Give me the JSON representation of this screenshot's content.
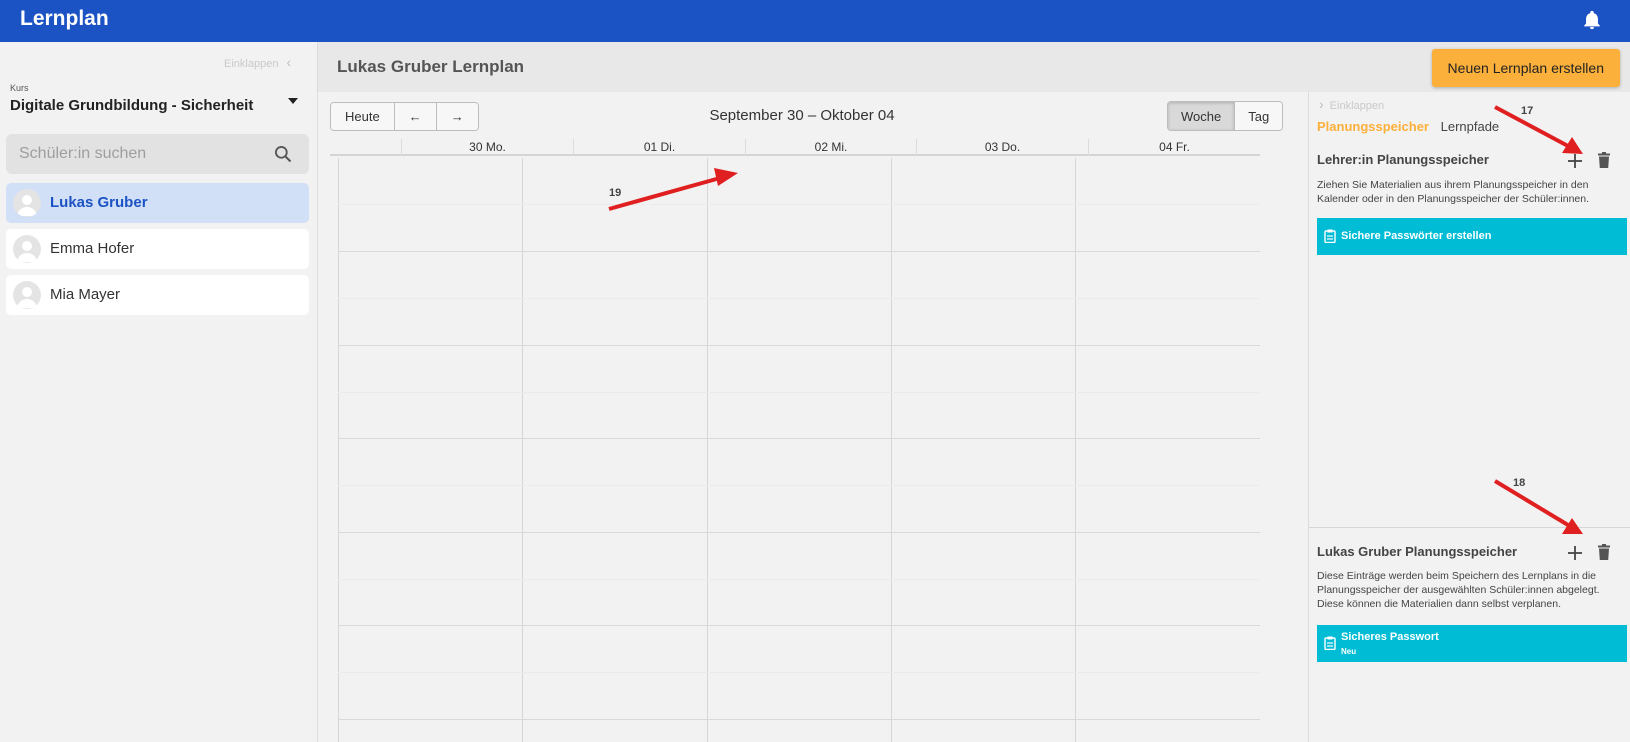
{
  "app": {
    "title": "Lernplan"
  },
  "sidebar": {
    "collapse_label": "Einklappen",
    "kurs_label": "Kurs",
    "kurs_value": "Digitale Grundbildung - Sicherheit",
    "search_placeholder": "Schüler:in suchen",
    "students": [
      {
        "name": "Lukas Gruber",
        "active": true
      },
      {
        "name": "Emma Hofer",
        "active": false
      },
      {
        "name": "Mia Mayer",
        "active": false
      }
    ]
  },
  "main": {
    "title": "Lukas Gruber Lernplan",
    "new_plan_button": "Neuen Lernplan erstellen"
  },
  "calendar": {
    "today_button": "Heute",
    "prev_button": "←",
    "next_button": "→",
    "date_range": "September 30 – Oktober 04",
    "view_week": "Woche",
    "view_day": "Tag",
    "active_view": "Woche",
    "days": [
      "30 Mo.",
      "01 Di.",
      "02 Mi.",
      "03 Do.",
      "04 Fr."
    ]
  },
  "right_panel": {
    "collapse_label": "Einklappen",
    "tab_active": "Planungsspeicher",
    "tab_other": "Lernpfade",
    "teacher_section": {
      "title": "Lehrer:in Planungsspeicher",
      "description": "Ziehen Sie Materialien aus ihrem Planungsspeicher in den Kalender oder in den Planungsspeicher der Schüler:innen.",
      "items": [
        {
          "title": "Sichere Passwörter erstellen"
        }
      ]
    },
    "student_section": {
      "title": "Lukas Gruber Planungsspeicher",
      "description": "Diese Einträge werden beim Speichern des Lernplans in die Planungsspeicher der ausgewählten Schüler:innen abgelegt. Diese können die Materialien dann selbst verplanen.",
      "items": [
        {
          "title": "Sicheres Passwort",
          "subtitle": "Neu"
        }
      ]
    }
  },
  "annotations": {
    "label_17": "17",
    "label_18": "18",
    "label_19": "19",
    "arrow_color": "#e02020"
  },
  "colors": {
    "topbar": "#1c53c4",
    "accent_orange": "#fbb03b",
    "material_cyan": "#00bcd4",
    "active_student_bg": "#d1dff7"
  },
  "icons": [
    "bell-icon",
    "chevron-left-icon",
    "caret-down-icon",
    "search-icon",
    "avatar-icon",
    "chevron-right-icon",
    "plus-icon",
    "trash-icon",
    "clipboard-icon"
  ]
}
